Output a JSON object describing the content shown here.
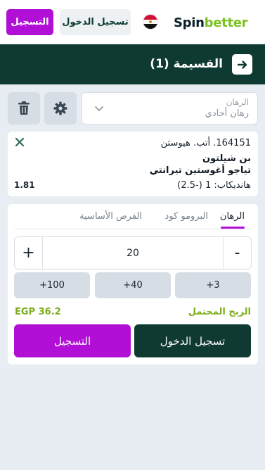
{
  "header": {
    "logo_left": "Spin",
    "logo_right": "better",
    "login_label": "تسجيل الدخول",
    "register_label": "التسجيل",
    "country_flag": "egypt-flag"
  },
  "bar": {
    "title": "القسيمة (1)",
    "back_icon": "arrow-right-icon"
  },
  "controls": {
    "bet_type_label": "الرهان",
    "bet_type_value": "رهان أحادي",
    "settings_icon": "gear-icon",
    "delete_icon": "trash-icon"
  },
  "bet": {
    "event_line": "164151. أتب. هيوستن",
    "player_1": "بن شيلتون",
    "player_2": "تياجو أغوستين تيرانتي",
    "market": "هانديكاب: 1 (-2.5)",
    "odds": "1.81"
  },
  "panel": {
    "tabs": [
      {
        "label": "الرهان",
        "active": true
      },
      {
        "label": "البرومو كود",
        "active": false
      },
      {
        "label": "الفرص الأساسية",
        "active": false
      }
    ],
    "stake": "20",
    "minus": "-",
    "plus": "+",
    "quick_amounts": [
      "+3",
      "+40",
      "+100"
    ],
    "profit_label": "الربح المحتمل",
    "profit_value": "EGP 36.2",
    "login_label": "تسجيل الدخول",
    "register_label": "التسجيل"
  },
  "colors": {
    "brand_green": "#0f3a32",
    "accent_purple": "#b10fd6",
    "lime": "#7cc21e"
  }
}
